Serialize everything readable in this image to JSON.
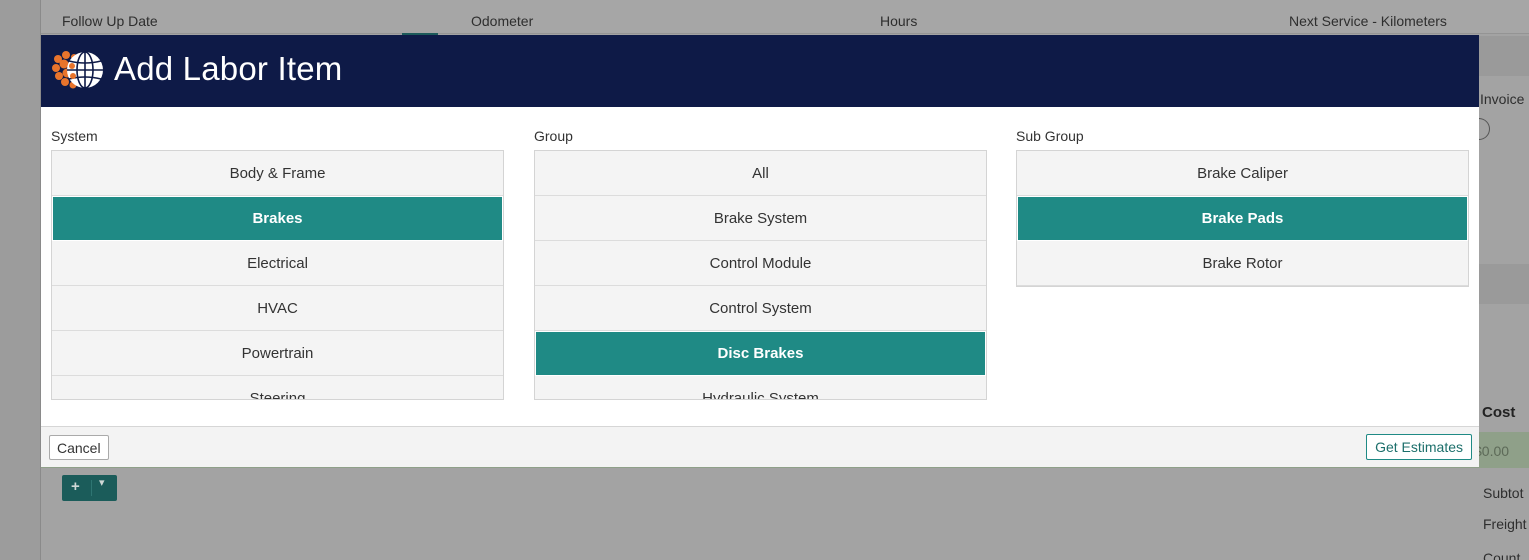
{
  "background": {
    "columns": [
      "Follow Up Date",
      "Odometer",
      "Hours",
      "Next Service - Kilometers"
    ],
    "right_labels": {
      "invoice": "Invoice",
      "cost": "Cost",
      "amount": "$0.00",
      "subtotal": "Subtot",
      "freight": "Freight",
      "count": "Count"
    },
    "add_button": {
      "plus": "+",
      "caret": "▾"
    }
  },
  "modal": {
    "title": "Add Labor Item",
    "system": {
      "label": "System",
      "selected": "Brakes",
      "items": [
        "Body & Frame",
        "Brakes",
        "Electrical",
        "HVAC",
        "Powertrain",
        "Steering"
      ]
    },
    "group": {
      "label": "Group",
      "selected": "Disc Brakes",
      "items": [
        "All",
        "Brake System",
        "Control Module",
        "Control System",
        "Disc Brakes",
        "Hydraulic System"
      ]
    },
    "subgroup": {
      "label": "Sub Group",
      "selected": "Brake Pads",
      "items": [
        "Brake Caliper",
        "Brake Pads",
        "Brake Rotor"
      ]
    },
    "footer": {
      "cancel_label": "Cancel",
      "estimates_label": "Get Estimates"
    }
  },
  "colors": {
    "header_navy": "#0e1a47",
    "accent_teal": "#1f8a85",
    "logo_orange": "#e8742c"
  }
}
